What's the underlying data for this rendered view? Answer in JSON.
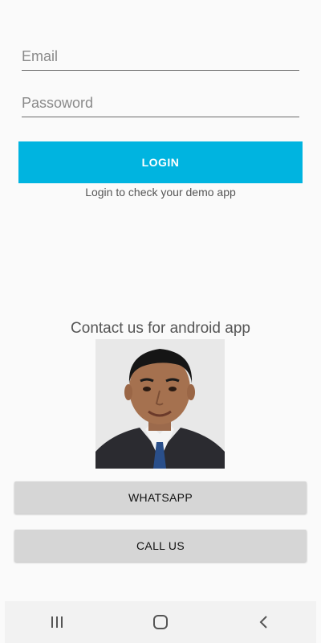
{
  "login": {
    "email_placeholder": "Email",
    "password_placeholder": "Passoword",
    "button_label": "LOGIN",
    "hint": "Login to check your demo app"
  },
  "contact": {
    "title": "Contact us for android app",
    "whatsapp_label": "WHATSAPP",
    "call_label": "CALL US"
  },
  "colors": {
    "accent": "#00b4e0",
    "button_gray": "#d6d6d6",
    "background": "#fafafa"
  },
  "nav": {
    "recents_icon": "recents-icon",
    "home_icon": "home-icon",
    "back_icon": "back-icon"
  }
}
